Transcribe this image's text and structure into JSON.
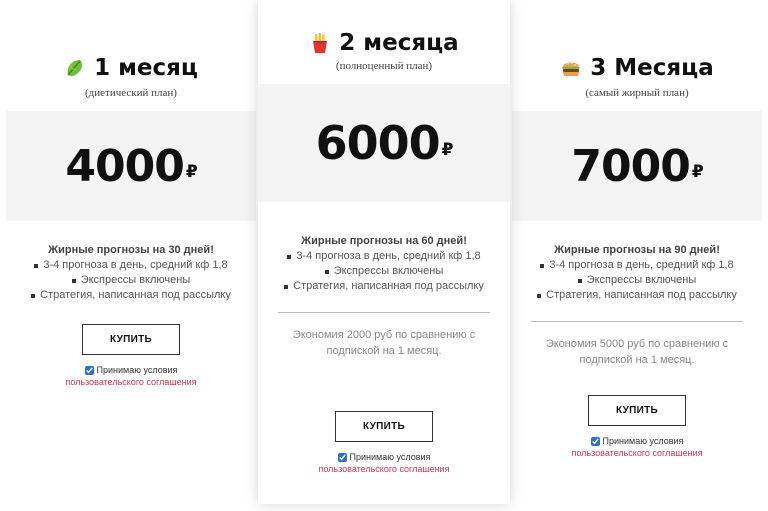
{
  "plans": [
    {
      "title": "1 месяц",
      "emoji_icon": "lettuce-icon",
      "subtitle": "(диетический план)",
      "price": "4000",
      "currency": "₽",
      "features_title": "Жирные прогнозы на 30 дней!",
      "features": [
        "3-4 прогноза в день, средний кф 1,8",
        "Экспрессы включены",
        "Стратегия, написанная под рассылку"
      ],
      "savings": "",
      "buy_label": "КУПИТЬ",
      "agree_text": "Принимаю условия",
      "terms_link": "пользовательского соглашения"
    },
    {
      "title": "2 месяца",
      "emoji_icon": "fries-icon",
      "subtitle": "(полноценный план)",
      "price": "6000",
      "currency": "₽",
      "features_title": "Жирные прогнозы на 60 дней!",
      "features": [
        "3-4 прогноза в день, средний кф 1,8",
        "Экспрессы включены",
        "Стратегия, написанная под рассылку"
      ],
      "savings": "Экономия 2000 руб по сравнению с подпиской на 1 месяц.",
      "buy_label": "КУПИТЬ",
      "agree_text": "Принимаю условия",
      "terms_link": "пользовательского соглашения"
    },
    {
      "title": "3 Месяца",
      "emoji_icon": "burger-icon",
      "subtitle": "(самый жирный план)",
      "price": "7000",
      "currency": "₽",
      "features_title": "Жирные прогнозы на 90 дней!",
      "features": [
        "3-4 прогноза в день, средний кф 1,8",
        "Экспрессы включены",
        "Стратегия, написанная под рассылку"
      ],
      "savings": "Экономия 5000 руб по сравнению с подпиской на 1 месяц.",
      "buy_label": "КУПИТЬ",
      "agree_text": "Принимаю условия",
      "terms_link": "пользовательского соглашения"
    }
  ],
  "colors": {
    "accent_link": "#d0334a",
    "price_bg": "#f4f4f4",
    "checkbox": "#2b6fd6"
  }
}
